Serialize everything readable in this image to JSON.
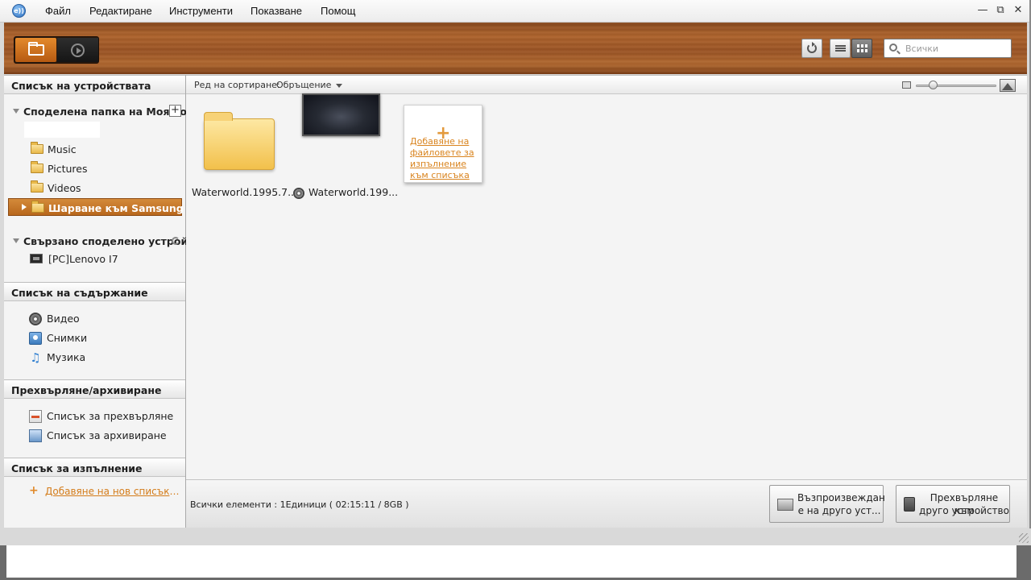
{
  "menu": {
    "logo": "e))",
    "items": [
      "Файл",
      "Редактиране",
      "Инструменти",
      "Показване",
      "Помощ"
    ]
  },
  "toolbar": {
    "search_placeholder": "Всички"
  },
  "sidebar": {
    "devices_header": "Списък на устройствата",
    "shared_folder": "Споделена папка на Моя ко...",
    "folders": [
      "Music",
      "Pictures",
      "Videos"
    ],
    "selected_folder": "Шарване към Samsung",
    "connected_header": "Свързано споделено устрой...",
    "pc_device": "[PC]Lenovo I7",
    "content_header": "Списък на съдържание",
    "content_items": [
      "Видео",
      "Снимки",
      "Музика"
    ],
    "transfer_header": "Прехвърляне/архивиране",
    "transfer_items": [
      "Списък за прехвърляне",
      "Списък за архивиране"
    ],
    "playlist_header": "Списък за изпълнение",
    "add_playlist": "Добавяне на нов списък за изп..."
  },
  "main": {
    "sort_label": "Ред на сортиране:",
    "sort_value": "Обръщение",
    "tiles": [
      "Waterworld.1995.7...",
      "Waterworld.199..."
    ],
    "add_card_text": "Добавяне на файловете за изпълнение към списъка",
    "status": "Всички елементи : 1Единици ( 02:15:11 / 8GB )",
    "play_btn_line1": "Възпроизвеждан",
    "play_btn_line2": "е на друго уст...",
    "xfer_btn_line1": "Прехвърляне към",
    "xfer_btn_line2": "друго устройство"
  },
  "colors": {
    "accent": "#d9841f",
    "selection": "#c7772c",
    "wood": "#a85c28"
  }
}
